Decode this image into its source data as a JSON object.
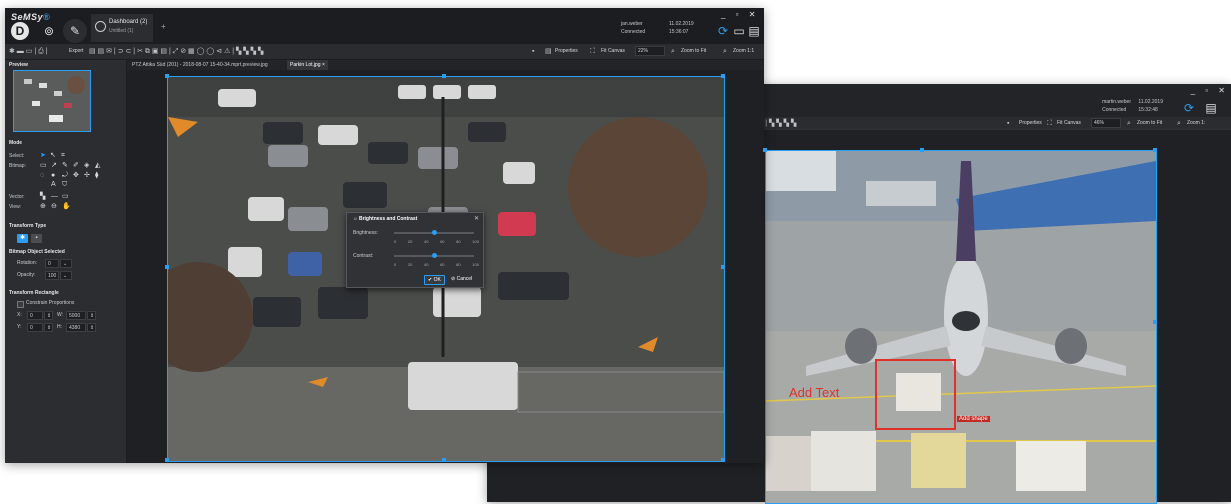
{
  "app": {
    "logo": "SeMSy",
    "logo_sup": "®"
  },
  "window1": {
    "tab": {
      "title": "Dashboard (2)",
      "subtitle": "Untitled (1)"
    },
    "user": {
      "name": "jan.weber",
      "status": "Connected"
    },
    "date": "11.02.2019",
    "time": "15:36:07",
    "toolbar": {
      "export_label": "Export",
      "properties_label": "Properties",
      "fit_canvas_label": "Fit Canvas",
      "zoom_value": "22%",
      "zoom_to_fit_label": "Zoom to Fit",
      "zoom_1_1_label": "Zoom 1:1"
    },
    "left_panel": {
      "preview_title": "Preview",
      "mode_title": "Mode",
      "select_label": "Select:",
      "bitmap_label": "Bitmap:",
      "vector_label": "Vector:",
      "view_label": "View:",
      "transform_type_title": "Transform Type",
      "bitmap_object_title": "Bitmap Object Selected",
      "rotation_label": "Rotation:",
      "rotation_value": "0",
      "opacity_label": "Opacity:",
      "opacity_value": "100",
      "transform_rect_title": "Transform Rectangle",
      "constrain_label": "Constrain Proportions",
      "x_label": "X:",
      "x_value": "0",
      "y_label": "Y:",
      "y_value": "0",
      "w_label": "W:",
      "w_value": "5000",
      "h_label": "H:",
      "h_value": "4380"
    },
    "doc_tabs": [
      {
        "label": "PTZ Attika Süd (201) - 2018-08-07 15-40-34.mprt.preview.jpg"
      },
      {
        "label": "Parkin Lot.jpg",
        "close": "×"
      }
    ],
    "dialog": {
      "title": "Brightness and Contrast",
      "brightness_label": "Brightness:",
      "contrast_label": "Contrast:",
      "ticks": [
        "0",
        "20",
        "40",
        "60",
        "80",
        "100"
      ],
      "brightness_value": 50,
      "contrast_value": 50,
      "ok_label": "OK",
      "cancel_label": "Cancel"
    }
  },
  "window2": {
    "user": {
      "name": "martin.weber",
      "status": "Connected"
    },
    "date": "11.02.2019",
    "time": "15:32:48",
    "toolbar": {
      "properties_label": "Properties",
      "fit_canvas_label": "Fit Canvas",
      "zoom_value": "46%",
      "zoom_to_fit_label": "Zoom to Fit",
      "zoom_1_1_label": "Zoom 1:"
    },
    "annotations": {
      "add_text": "Add Text",
      "add_shape": "Add shape"
    }
  },
  "colors": {
    "accent": "#2a9df4",
    "annotation_red": "#e0302a",
    "panel_bg": "#2b2d31",
    "titlebar_bg": "#1c1d20"
  }
}
